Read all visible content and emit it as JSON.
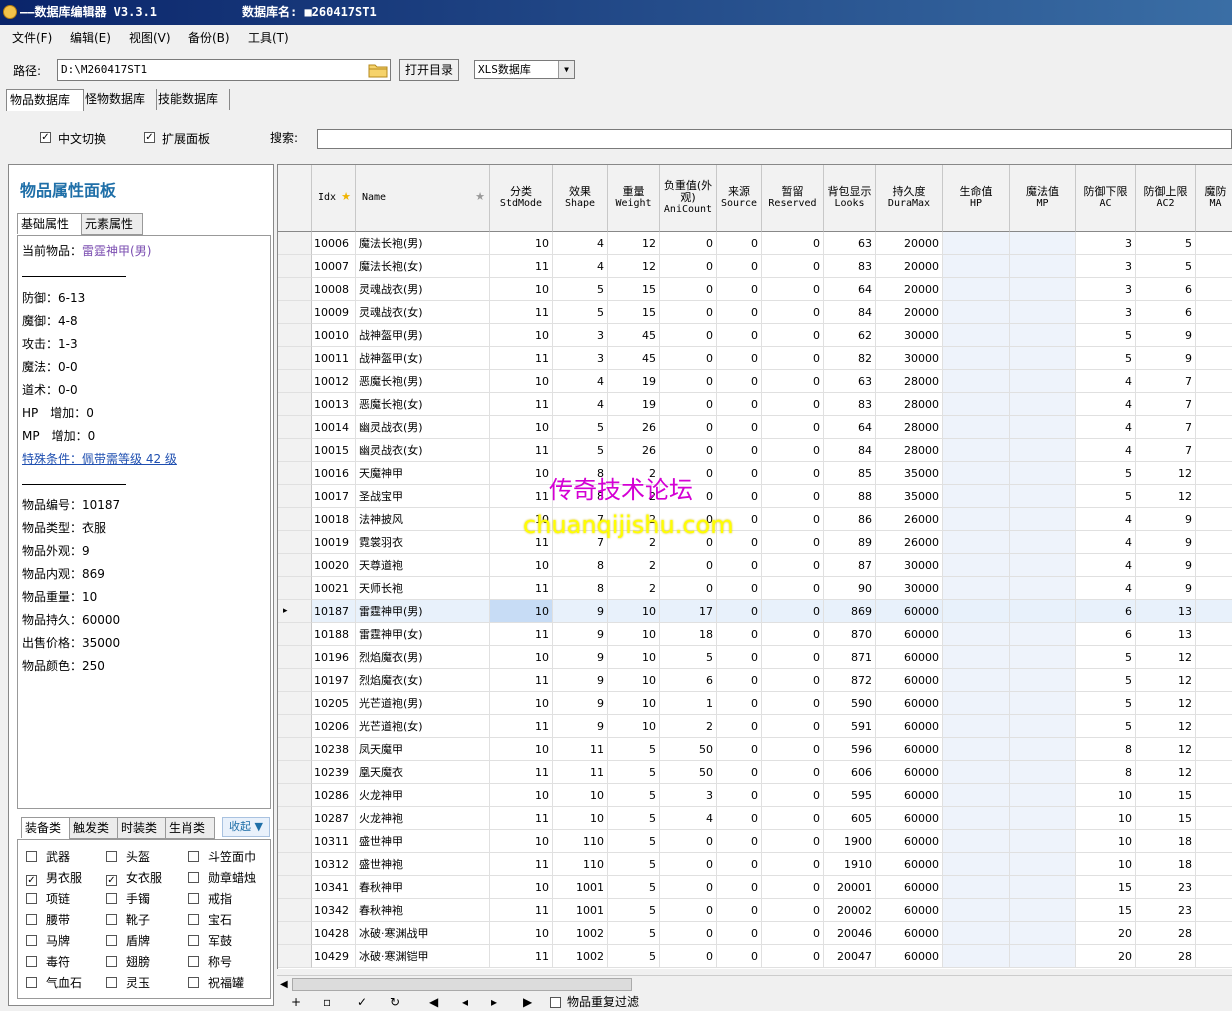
{
  "window": {
    "app_title": "——数据库编辑器 V3.3.1",
    "db_name_label": "数据库名: ■260417ST1"
  },
  "menu": [
    "文件(F)",
    "编辑(E)",
    "视图(V)",
    "备份(B)",
    "工具(T)"
  ],
  "path": {
    "label": "路径:",
    "value": "D:\\M260417ST1",
    "open_button": "打开目录",
    "db_type": "XLS数据库"
  },
  "db_tabs": [
    "物品数据库",
    "怪物数据库",
    "技能数据库"
  ],
  "options": {
    "chinese_switch": "中文切换",
    "chinese_switch_checked": true,
    "expand_panel": "扩展面板",
    "expand_panel_checked": true,
    "search_label": "搜索:"
  },
  "panel": {
    "title": "物品属性面板",
    "tabs": [
      "基础属性",
      "元素属性"
    ],
    "current_label": "当前物品：",
    "current_value": "雷霆神甲(男)",
    "stats": [
      "防御：6-13",
      "魔御：4-8",
      "攻击：1-3",
      "魔法：0-0",
      "道术：0-0",
      "HP　增加：0",
      "MP　增加：0"
    ],
    "special": "特殊条件：佩带需等级 42 级",
    "info": [
      "物品编号：10187",
      "物品类型：衣服",
      "物品外观：9",
      "物品内观：869",
      "物品重量：10",
      "物品持久：60000",
      "出售价格：35000",
      "物品颜色：250"
    ]
  },
  "category_tabs": [
    "装备类",
    "触发类",
    "时装类",
    "生肖类"
  ],
  "collapse_label": "收起 ▼",
  "categories": [
    {
      "label": "武器",
      "checked": false
    },
    {
      "label": "头盔",
      "checked": false
    },
    {
      "label": "斗笠面巾",
      "checked": false
    },
    {
      "label": "男衣服",
      "checked": true
    },
    {
      "label": "女衣服",
      "checked": true
    },
    {
      "label": "勋章蜡烛",
      "checked": false
    },
    {
      "label": "项链",
      "checked": false
    },
    {
      "label": "手镯",
      "checked": false
    },
    {
      "label": "戒指",
      "checked": false
    },
    {
      "label": "腰带",
      "checked": false
    },
    {
      "label": "靴子",
      "checked": false
    },
    {
      "label": "宝石",
      "checked": false
    },
    {
      "label": "马牌",
      "checked": false
    },
    {
      "label": "盾牌",
      "checked": false
    },
    {
      "label": "军鼓",
      "checked": false
    },
    {
      "label": "毒符",
      "checked": false
    },
    {
      "label": "翅膀",
      "checked": false
    },
    {
      "label": "称号",
      "checked": false
    },
    {
      "label": "气血石",
      "checked": false
    },
    {
      "label": "灵玉",
      "checked": false
    },
    {
      "label": "祝福罐",
      "checked": false
    }
  ],
  "grid": {
    "columns": [
      {
        "cn": "",
        "en": "Idx"
      },
      {
        "cn": "",
        "en": "Name"
      },
      {
        "cn": "分类",
        "en": "StdMode"
      },
      {
        "cn": "效果",
        "en": "Shape"
      },
      {
        "cn": "重量",
        "en": "Weight"
      },
      {
        "cn": "负重值(外观)",
        "en": "AniCount"
      },
      {
        "cn": "来源",
        "en": "Source"
      },
      {
        "cn": "暂留",
        "en": "Reserved"
      },
      {
        "cn": "背包显示",
        "en": "Looks"
      },
      {
        "cn": "持久度",
        "en": "DuraMax"
      },
      {
        "cn": "生命值",
        "en": "HP"
      },
      {
        "cn": "魔法值",
        "en": "MP"
      },
      {
        "cn": "防御下限",
        "en": "AC"
      },
      {
        "cn": "防御上限",
        "en": "AC2"
      },
      {
        "cn": "魔防",
        "en": "MA"
      }
    ],
    "current_row_index": 16,
    "rows": [
      [
        "10006",
        "魔法长袍(男)",
        "10",
        "4",
        "12",
        "0",
        "0",
        "0",
        "63",
        "20000",
        "",
        "",
        "3",
        "5"
      ],
      [
        "10007",
        "魔法长袍(女)",
        "11",
        "4",
        "12",
        "0",
        "0",
        "0",
        "83",
        "20000",
        "",
        "",
        "3",
        "5"
      ],
      [
        "10008",
        "灵魂战衣(男)",
        "10",
        "5",
        "15",
        "0",
        "0",
        "0",
        "64",
        "20000",
        "",
        "",
        "3",
        "6"
      ],
      [
        "10009",
        "灵魂战衣(女)",
        "11",
        "5",
        "15",
        "0",
        "0",
        "0",
        "84",
        "20000",
        "",
        "",
        "3",
        "6"
      ],
      [
        "10010",
        "战神盔甲(男)",
        "10",
        "3",
        "45",
        "0",
        "0",
        "0",
        "62",
        "30000",
        "",
        "",
        "5",
        "9"
      ],
      [
        "10011",
        "战神盔甲(女)",
        "11",
        "3",
        "45",
        "0",
        "0",
        "0",
        "82",
        "30000",
        "",
        "",
        "5",
        "9"
      ],
      [
        "10012",
        "恶魔长袍(男)",
        "10",
        "4",
        "19",
        "0",
        "0",
        "0",
        "63",
        "28000",
        "",
        "",
        "4",
        "7"
      ],
      [
        "10013",
        "恶魔长袍(女)",
        "11",
        "4",
        "19",
        "0",
        "0",
        "0",
        "83",
        "28000",
        "",
        "",
        "4",
        "7"
      ],
      [
        "10014",
        "幽灵战衣(男)",
        "10",
        "5",
        "26",
        "0",
        "0",
        "0",
        "64",
        "28000",
        "",
        "",
        "4",
        "7"
      ],
      [
        "10015",
        "幽灵战衣(女)",
        "11",
        "5",
        "26",
        "0",
        "0",
        "0",
        "84",
        "28000",
        "",
        "",
        "4",
        "7"
      ],
      [
        "10016",
        "天魔神甲",
        "10",
        "8",
        "2",
        "0",
        "0",
        "0",
        "85",
        "35000",
        "",
        "",
        "5",
        "12"
      ],
      [
        "10017",
        "圣战宝甲",
        "11",
        "8",
        "2",
        "0",
        "0",
        "0",
        "88",
        "35000",
        "",
        "",
        "5",
        "12"
      ],
      [
        "10018",
        "法神披风",
        "10",
        "7",
        "2",
        "0",
        "0",
        "0",
        "86",
        "26000",
        "",
        "",
        "4",
        "9"
      ],
      [
        "10019",
        "霓裳羽衣",
        "11",
        "7",
        "2",
        "0",
        "0",
        "0",
        "89",
        "26000",
        "",
        "",
        "4",
        "9"
      ],
      [
        "10020",
        "天尊道袍",
        "10",
        "8",
        "2",
        "0",
        "0",
        "0",
        "87",
        "30000",
        "",
        "",
        "4",
        "9"
      ],
      [
        "10021",
        "天师长袍",
        "11",
        "8",
        "2",
        "0",
        "0",
        "0",
        "90",
        "30000",
        "",
        "",
        "4",
        "9"
      ],
      [
        "10187",
        "雷霆神甲(男)",
        "10",
        "9",
        "10",
        "17",
        "0",
        "0",
        "869",
        "60000",
        "",
        "",
        "6",
        "13"
      ],
      [
        "10188",
        "雷霆神甲(女)",
        "11",
        "9",
        "10",
        "18",
        "0",
        "0",
        "870",
        "60000",
        "",
        "",
        "6",
        "13"
      ],
      [
        "10196",
        "烈焰魔衣(男)",
        "10",
        "9",
        "10",
        "5",
        "0",
        "0",
        "871",
        "60000",
        "",
        "",
        "5",
        "12"
      ],
      [
        "10197",
        "烈焰魔衣(女)",
        "11",
        "9",
        "10",
        "6",
        "0",
        "0",
        "872",
        "60000",
        "",
        "",
        "5",
        "12"
      ],
      [
        "10205",
        "光芒道袍(男)",
        "10",
        "9",
        "10",
        "1",
        "0",
        "0",
        "590",
        "60000",
        "",
        "",
        "5",
        "12"
      ],
      [
        "10206",
        "光芒道袍(女)",
        "11",
        "9",
        "10",
        "2",
        "0",
        "0",
        "591",
        "60000",
        "",
        "",
        "5",
        "12"
      ],
      [
        "10238",
        "凤天魔甲",
        "10",
        "11",
        "5",
        "50",
        "0",
        "0",
        "596",
        "60000",
        "",
        "",
        "8",
        "12"
      ],
      [
        "10239",
        "凰天魔衣",
        "11",
        "11",
        "5",
        "50",
        "0",
        "0",
        "606",
        "60000",
        "",
        "",
        "8",
        "12"
      ],
      [
        "10286",
        "火龙神甲",
        "10",
        "10",
        "5",
        "3",
        "0",
        "0",
        "595",
        "60000",
        "",
        "",
        "10",
        "15"
      ],
      [
        "10287",
        "火龙神袍",
        "11",
        "10",
        "5",
        "4",
        "0",
        "0",
        "605",
        "60000",
        "",
        "",
        "10",
        "15"
      ],
      [
        "10311",
        "盛世神甲",
        "10",
        "110",
        "5",
        "0",
        "0",
        "0",
        "1900",
        "60000",
        "",
        "",
        "10",
        "18"
      ],
      [
        "10312",
        "盛世神袍",
        "11",
        "110",
        "5",
        "0",
        "0",
        "0",
        "1910",
        "60000",
        "",
        "",
        "10",
        "18"
      ],
      [
        "10341",
        "春秋神甲",
        "10",
        "1001",
        "5",
        "0",
        "0",
        "0",
        "20001",
        "60000",
        "",
        "",
        "15",
        "23"
      ],
      [
        "10342",
        "春秋神袍",
        "11",
        "1001",
        "5",
        "0",
        "0",
        "0",
        "20002",
        "60000",
        "",
        "",
        "15",
        "23"
      ],
      [
        "10428",
        "冰破·寒渊战甲",
        "10",
        "1002",
        "5",
        "0",
        "0",
        "0",
        "20046",
        "60000",
        "",
        "",
        "20",
        "28"
      ],
      [
        "10429",
        "冰破·寒渊铠甲",
        "11",
        "1002",
        "5",
        "0",
        "0",
        "0",
        "20047",
        "60000",
        "",
        "",
        "20",
        "28"
      ]
    ]
  },
  "navigator": {
    "buttons": [
      "+",
      "▫",
      "✓",
      "↻",
      "◀",
      "◂",
      "▸",
      "▶"
    ],
    "filter_label": "物品重复过滤"
  },
  "watermark": {
    "line1": "传奇技术论坛",
    "line2": "chuanqijishu.com"
  }
}
